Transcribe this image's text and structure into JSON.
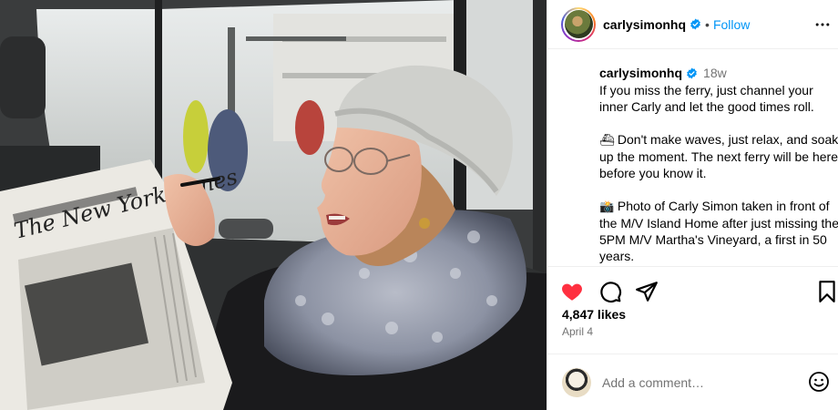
{
  "post": {
    "username": "carlysimonhq",
    "verified": true,
    "follow_label": "Follow",
    "separator": "•",
    "time_ago": "18w",
    "caption_paragraphs": [
      {
        "emoji": "⛴",
        "text": "If you miss the ferry, just channel your inner Carly and let the good times roll."
      },
      {
        "emoji": "⛴",
        "text": "Don't make waves, just relax, and soak up the moment. The next ferry will be here before you know it."
      },
      {
        "emoji": "📸",
        "text": "Photo of Carly Simon taken in front of the M/V Island Home after just missing the 5PM M/V Martha's Vineyard, a first in 50 years."
      }
    ],
    "likes": "4,847 likes",
    "date": "April 4",
    "comment_placeholder": "Add a comment…",
    "newspaper_masthead": "The New York Times"
  },
  "icons": {
    "verified": "verified-badge-icon",
    "more": "more-options-icon",
    "like": "heart-icon",
    "comment": "comment-icon",
    "share": "share-icon",
    "save": "bookmark-icon",
    "emoji": "emoji-icon"
  },
  "colors": {
    "link_blue": "#0095f6",
    "like_red": "#ff3040",
    "muted": "#737373"
  }
}
